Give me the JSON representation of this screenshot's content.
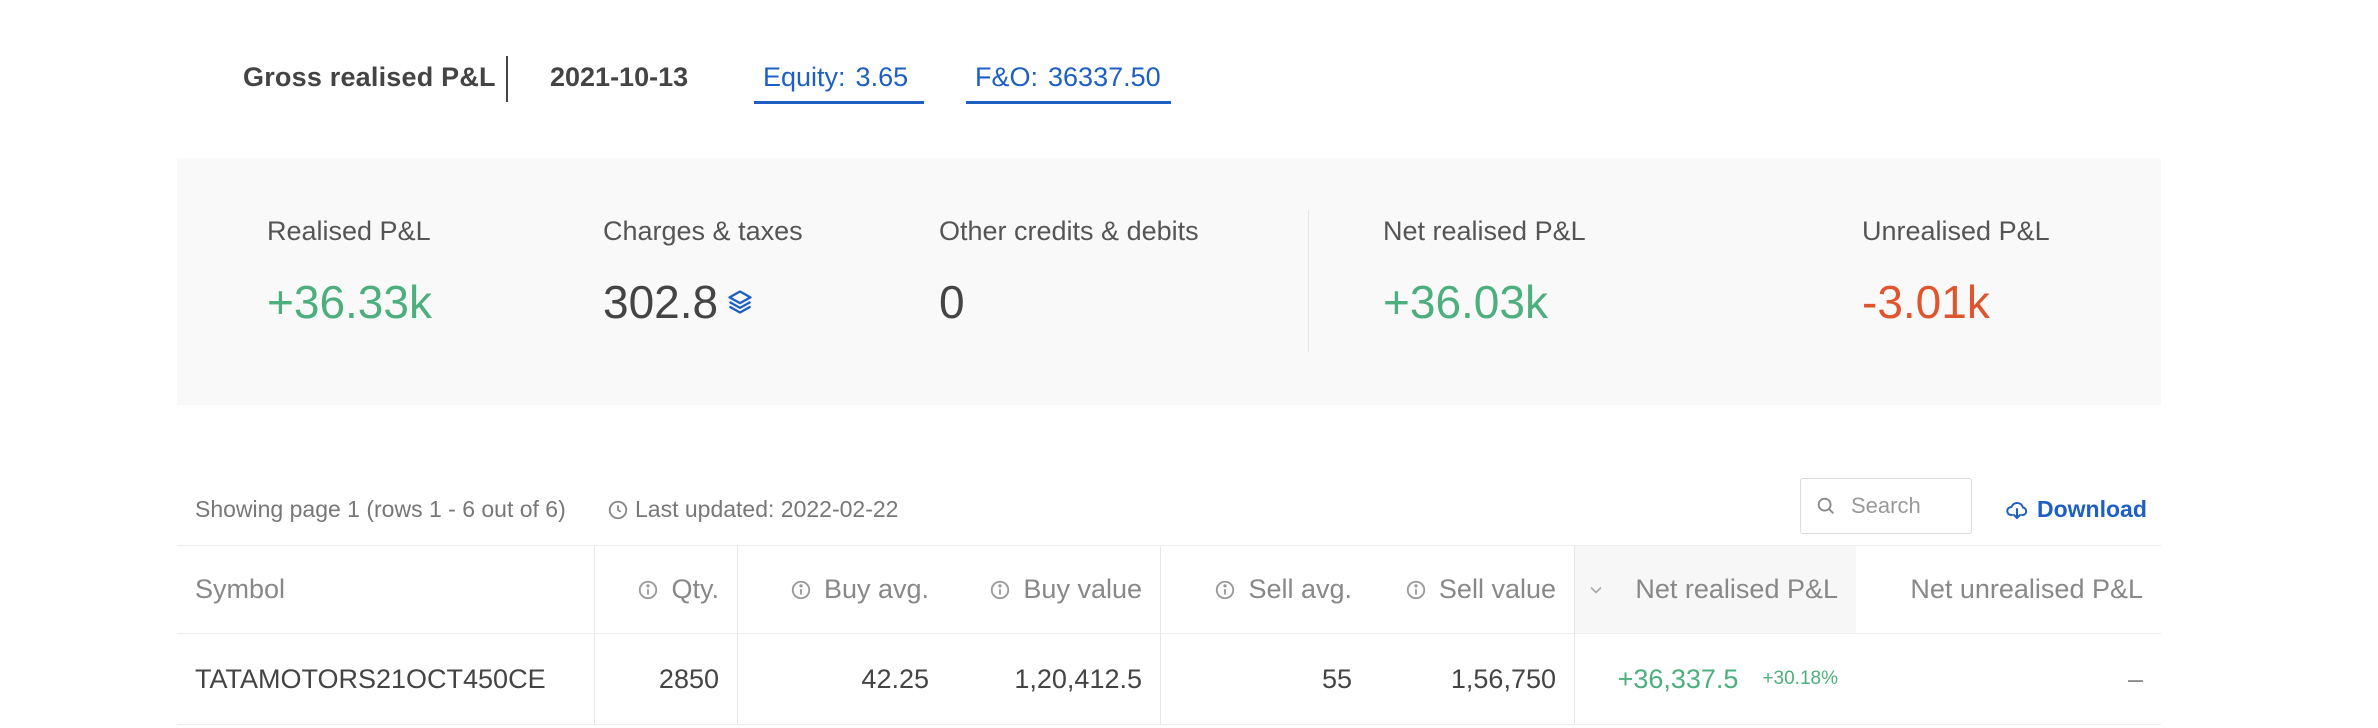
{
  "header": {
    "title": "Gross realised P&L",
    "date": "2021-10-13",
    "tabs": [
      {
        "label": "Equity:",
        "value": "3.65"
      },
      {
        "label": "F&O:",
        "value": "36337.50"
      }
    ]
  },
  "summary": {
    "realised": {
      "label": "Realised P&L",
      "value": "+36.33k"
    },
    "charges": {
      "label": "Charges & taxes",
      "value": "302.8"
    },
    "other": {
      "label": "Other credits & debits",
      "value": "0"
    },
    "net": {
      "label": "Net realised P&L",
      "value": "+36.03k"
    },
    "unrealised": {
      "label": "Unrealised P&L",
      "value": "-3.01k"
    }
  },
  "toolbar": {
    "showing": "Showing page 1 (rows 1 - 6 out of 6)",
    "updated": "Last updated: 2022-02-22",
    "search_placeholder": "Search",
    "download_label": "Download"
  },
  "table": {
    "columns": {
      "symbol": "Symbol",
      "qty": "Qty.",
      "buy_avg": "Buy avg.",
      "buy_value": "Buy value",
      "sell_avg": "Sell avg.",
      "sell_value": "Sell value",
      "net_realised": "Net realised P&L",
      "net_unrealised": "Net unrealised P&L"
    },
    "rows": [
      {
        "symbol": "TATAMOTORS21OCT450CE",
        "qty": "2850",
        "buy_avg": "42.25",
        "buy_value": "1,20,412.5",
        "sell_avg": "55",
        "sell_value": "1,56,750",
        "net_realised": "+36,337.5",
        "net_realised_pct": "+30.18%",
        "net_unrealised": "–"
      }
    ]
  },
  "colors": {
    "accent": "#1e5fc4",
    "profit": "#4caf7d",
    "loss": "#e0552e"
  }
}
